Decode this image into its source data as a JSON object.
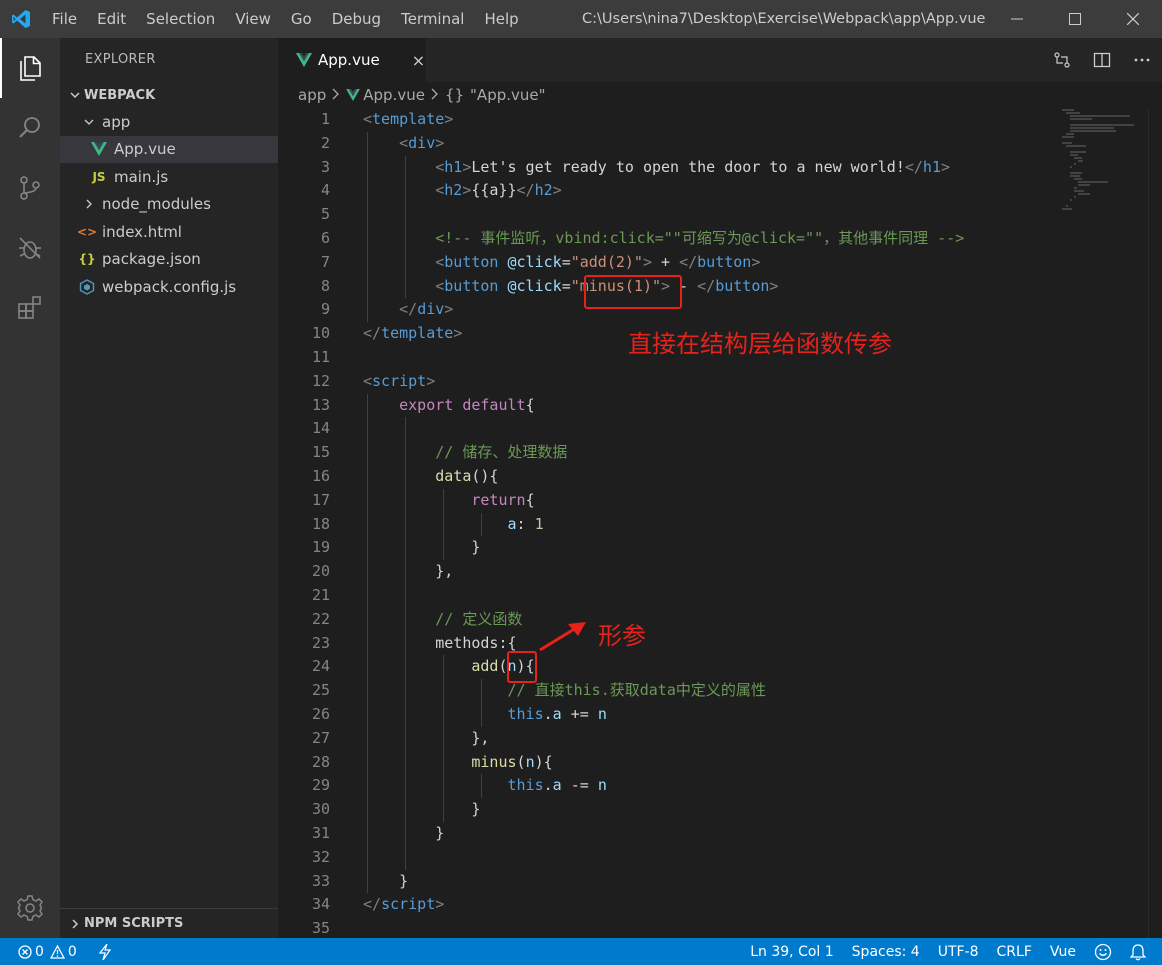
{
  "menu": [
    "File",
    "Edit",
    "Selection",
    "View",
    "Go",
    "Debug",
    "Terminal",
    "Help"
  ],
  "window_title": "C:\\Users\\nina7\\Desktop\\Exercise\\Webpack\\app\\App.vue",
  "sidebar": {
    "header": "EXPLORER",
    "section": "WEBPACK",
    "items": [
      {
        "label": "app",
        "type": "folder-open"
      },
      {
        "label": "App.vue",
        "type": "vue"
      },
      {
        "label": "main.js",
        "type": "js"
      },
      {
        "label": "node_modules",
        "type": "folder"
      },
      {
        "label": "index.html",
        "type": "html"
      },
      {
        "label": "package.json",
        "type": "json"
      },
      {
        "label": "webpack.config.js",
        "type": "webpack"
      }
    ],
    "footer": "NPM SCRIPTS"
  },
  "tab": {
    "label": "App.vue",
    "close": "×"
  },
  "breadcrumbs": {
    "folder": "app",
    "file": "App.vue",
    "symbol_icon": "{}",
    "symbol": "\"App.vue\""
  },
  "code": {
    "l1": [
      "<",
      "template",
      ">"
    ],
    "l2": [
      "<",
      "div",
      ">"
    ],
    "l3": [
      "<",
      "h1",
      ">",
      "Let's get ready to open the door to a new world!",
      "</",
      "h1",
      ">"
    ],
    "l4": [
      "<",
      "h2",
      ">",
      "{{a}}",
      "</",
      "h2",
      ">"
    ],
    "l6": "<!-- 事件监听，vbind:click=\"\"可缩写为@click=\"\"，其他事件同理 -->",
    "l7": [
      "<",
      "button",
      " @click",
      "=",
      "\"add(2)\"",
      ">",
      " + ",
      "</",
      "button",
      ">"
    ],
    "l8": [
      "<",
      "button",
      " @click",
      "=",
      "\"minus(1)\"",
      ">",
      " - ",
      "</",
      "button",
      ">"
    ],
    "l9": [
      "</",
      "div",
      ">"
    ],
    "l10": [
      "</",
      "template",
      ">"
    ],
    "l12": [
      "<",
      "script",
      ">"
    ],
    "l13": [
      "export default",
      "{"
    ],
    "l15": "// 储存、处理数据",
    "l16": [
      "data",
      "(){"
    ],
    "l17": [
      "return",
      "{"
    ],
    "l18": [
      "a",
      ": ",
      "1"
    ],
    "l19": "}",
    "l20": "},",
    "l22": "// 定义函数",
    "l23": [
      "methods",
      ":{"
    ],
    "l24": [
      "add",
      "(",
      "n",
      "){"
    ],
    "l25": "// 直接this.获取data中定义的属性",
    "l26": [
      "this",
      ".",
      "a",
      " += ",
      "n"
    ],
    "l27": "},",
    "l28": [
      "minus",
      "(",
      "n",
      "){"
    ],
    "l29": [
      "this",
      ".",
      "a",
      " -= ",
      "n"
    ],
    "l30": "}",
    "l31": "}",
    "l33": "}",
    "l34": [
      "</",
      "script",
      ">"
    ]
  },
  "annotations": {
    "structure_note": "直接在结构层给函数传参",
    "param_note": "形参"
  },
  "statusbar": {
    "errors": "0",
    "warnings": "0",
    "position": "Ln 39, Col 1",
    "spaces": "Spaces: 4",
    "encoding": "UTF-8",
    "eol": "CRLF",
    "language": "Vue"
  },
  "colors": {
    "accent": "#007acc",
    "annotation": "#e8211b",
    "vue_green": "#41b883"
  }
}
